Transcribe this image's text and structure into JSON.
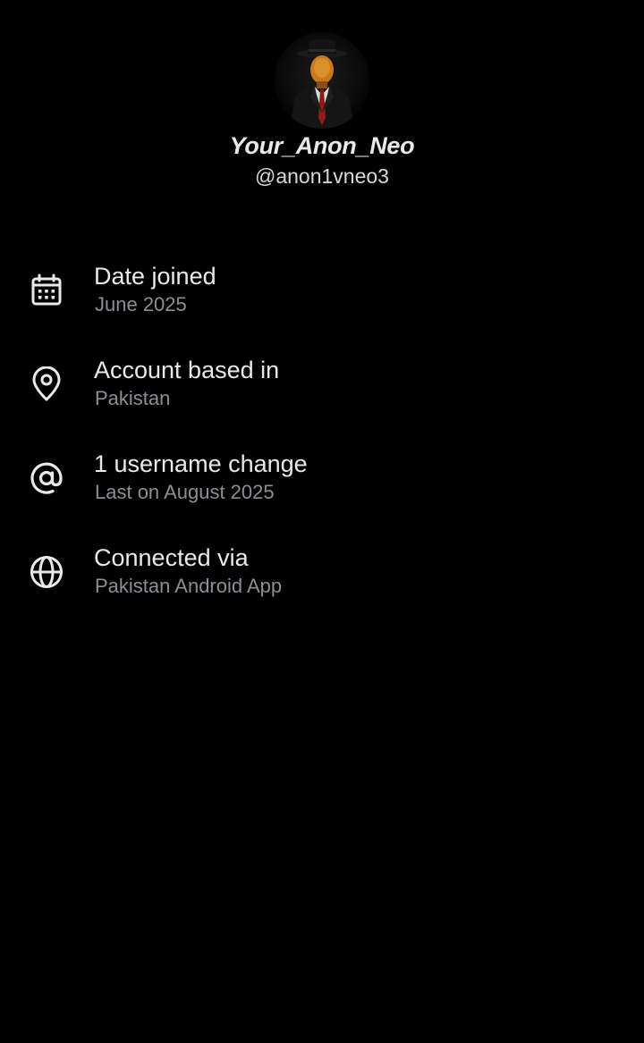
{
  "profile": {
    "display_name": "Your_Anon_Neo",
    "handle": "@anon1vneo3",
    "avatar_icon": "anonymous-man-in-hat-avatar"
  },
  "info": [
    {
      "icon": "calendar-icon",
      "title": "Date joined",
      "value": "June 2025"
    },
    {
      "icon": "location-pin-icon",
      "title": "Account based in",
      "value": "Pakistan"
    },
    {
      "icon": "at-sign-icon",
      "title": "1 username change",
      "value": "Last on August 2025"
    },
    {
      "icon": "globe-icon",
      "title": "Connected via",
      "value": "Pakistan Android App"
    }
  ],
  "colors": {
    "background": "#000000",
    "primary_text": "#e7e9ea",
    "secondary_text": "#8b8f93",
    "icon": "#e7e9ea"
  }
}
